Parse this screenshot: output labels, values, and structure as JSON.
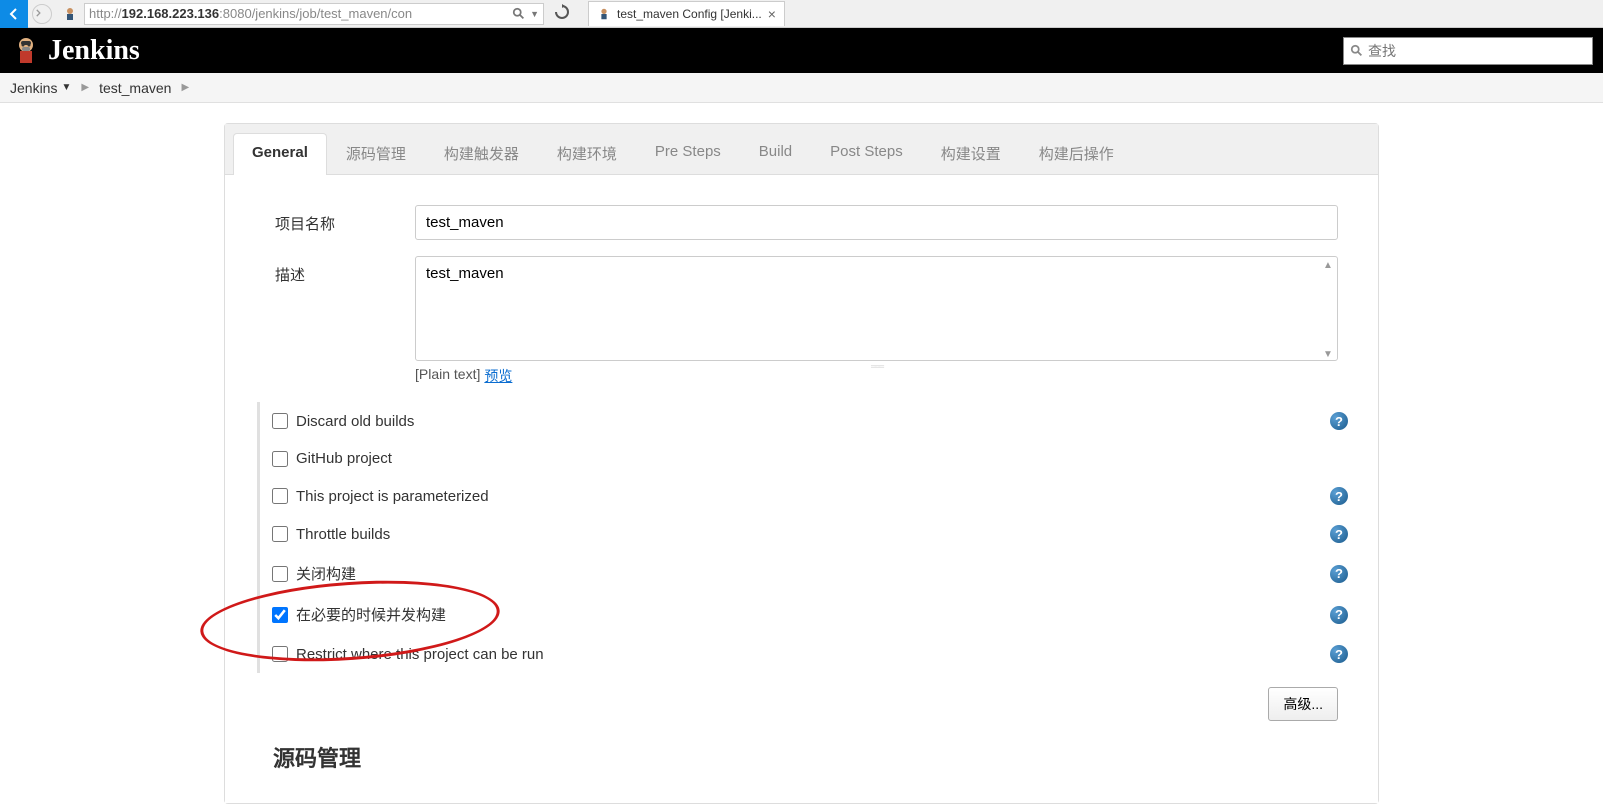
{
  "browser": {
    "url_prefix": "http://",
    "url_host": "192.168.223.136",
    "url_port": ":8080",
    "url_path": "/jenkins/job/test_maven/con",
    "tab_title": "test_maven Config [Jenki..."
  },
  "header": {
    "logo_text": "Jenkins",
    "search_placeholder": "查找"
  },
  "breadcrumb": {
    "items": [
      "Jenkins",
      "test_maven"
    ]
  },
  "tabs": [
    "General",
    "源码管理",
    "构建触发器",
    "构建环境",
    "Pre Steps",
    "Build",
    "Post Steps",
    "构建设置",
    "构建后操作"
  ],
  "active_tab_index": 0,
  "form": {
    "name_label": "项目名称",
    "name_value": "test_maven",
    "desc_label": "描述",
    "desc_value": "test_maven",
    "format_plain": "[Plain text]",
    "format_preview": "预览"
  },
  "options": [
    {
      "label": "Discard old builds",
      "checked": false,
      "help": true
    },
    {
      "label": "GitHub project",
      "checked": false,
      "help": false
    },
    {
      "label": "This project is parameterized",
      "checked": false,
      "help": true
    },
    {
      "label": "Throttle builds",
      "checked": false,
      "help": true
    },
    {
      "label": "关闭构建",
      "checked": false,
      "help": true
    },
    {
      "label": "在必要的时候并发构建",
      "checked": true,
      "help": true
    },
    {
      "label": "Restrict where this project can be run",
      "checked": false,
      "help": true
    }
  ],
  "advanced_button": "高级...",
  "next_section": "源码管理"
}
